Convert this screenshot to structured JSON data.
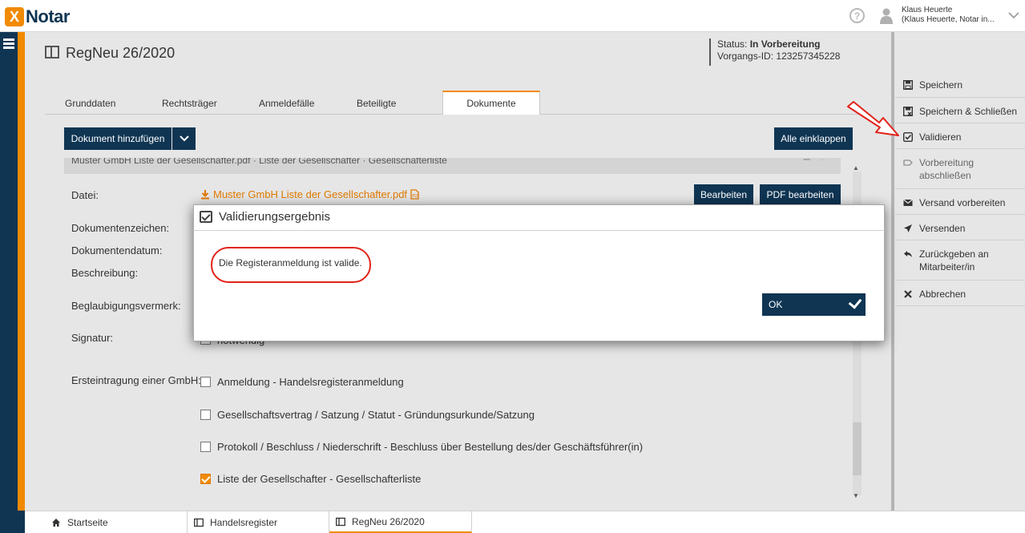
{
  "app": {
    "logo_mark": "X",
    "logo_name": "Notar"
  },
  "user": {
    "name": "Klaus Heuerte",
    "detail": "(Klaus Heuerte, Notar in..."
  },
  "header": {
    "title": "RegNeu 26/2020",
    "status_label": "Status:",
    "status_value": "In Vorbereitung",
    "vorgang_label": "Vorgangs-ID:",
    "vorgang_value": "123257345228"
  },
  "tabs": [
    {
      "label": "Grunddaten"
    },
    {
      "label": "Rechtsträger"
    },
    {
      "label": "Anmeldefälle"
    },
    {
      "label": "Beteiligte"
    },
    {
      "label": "Dokumente",
      "active": true
    }
  ],
  "toolbar": {
    "add_document": "Dokument hinzufügen",
    "collapse_all": "Alle einklappen"
  },
  "document": {
    "header_text": "Muster GmbH Liste der Gesellschafter.pdf · Liste der Gesellschafter · Gesellschafterliste",
    "file_label": "Datei:",
    "file_name": "Muster GmbH Liste der Gesellschafter.pdf",
    "edit_button": "Bearbeiten",
    "pdf_edit_button": "PDF bearbeiten",
    "fields": {
      "aktenzeichen": "Dokumentenzeichen:",
      "datum": "Dokumentendatum:",
      "beschreibung": "Beschreibung:",
      "beglaubigung": "Beglaubigungsvermerk:",
      "signatur": "Signatur:",
      "ersteintragung": "Ersteintragung einer GmbH:"
    },
    "signatur_option": "notwendig",
    "checkboxes": [
      {
        "label": "Anmeldung - Handelsregisteranmeldung",
        "checked": false
      },
      {
        "label": "Gesellschaftsvertrag / Satzung / Statut - Gründungsurkunde/Satzung",
        "checked": false
      },
      {
        "label": "Protokoll / Beschluss / Niederschrift - Beschluss über Bestellung des/der Geschäftsführer(in)",
        "checked": false
      },
      {
        "label": "Liste der Gesellschafter - Gesellschafterliste",
        "checked": true
      }
    ]
  },
  "actions": [
    {
      "icon": "save-icon",
      "label": "Speichern"
    },
    {
      "icon": "save-close-icon",
      "label": "Speichern & Schließen"
    },
    {
      "icon": "check-square-icon",
      "label": "Validieren"
    },
    {
      "icon": "finish-icon",
      "label": "Vorbereitung abschließen"
    },
    {
      "icon": "envelope-icon",
      "label": "Versand vorbereiten"
    },
    {
      "icon": "send-icon",
      "label": "Versenden"
    },
    {
      "icon": "reply-icon",
      "label": "Zurückgeben an Mitarbeiter/in"
    },
    {
      "icon": "x-icon",
      "label": "Abbrechen"
    }
  ],
  "bottom_tabs": [
    {
      "icon": "home-icon",
      "label": "Startseite"
    },
    {
      "icon": "book-icon",
      "label": "Handelsregister"
    },
    {
      "icon": "book-icon",
      "label": "RegNeu 26/2020",
      "active": true
    }
  ],
  "modal": {
    "title": "Validierungsergebnis",
    "message": "Die Registeranmeldung ist valide.",
    "ok_label": "OK"
  },
  "colors": {
    "brand_navy": "#0f3553",
    "brand_orange": "#f18a00",
    "annotation_red": "#e2231a"
  }
}
